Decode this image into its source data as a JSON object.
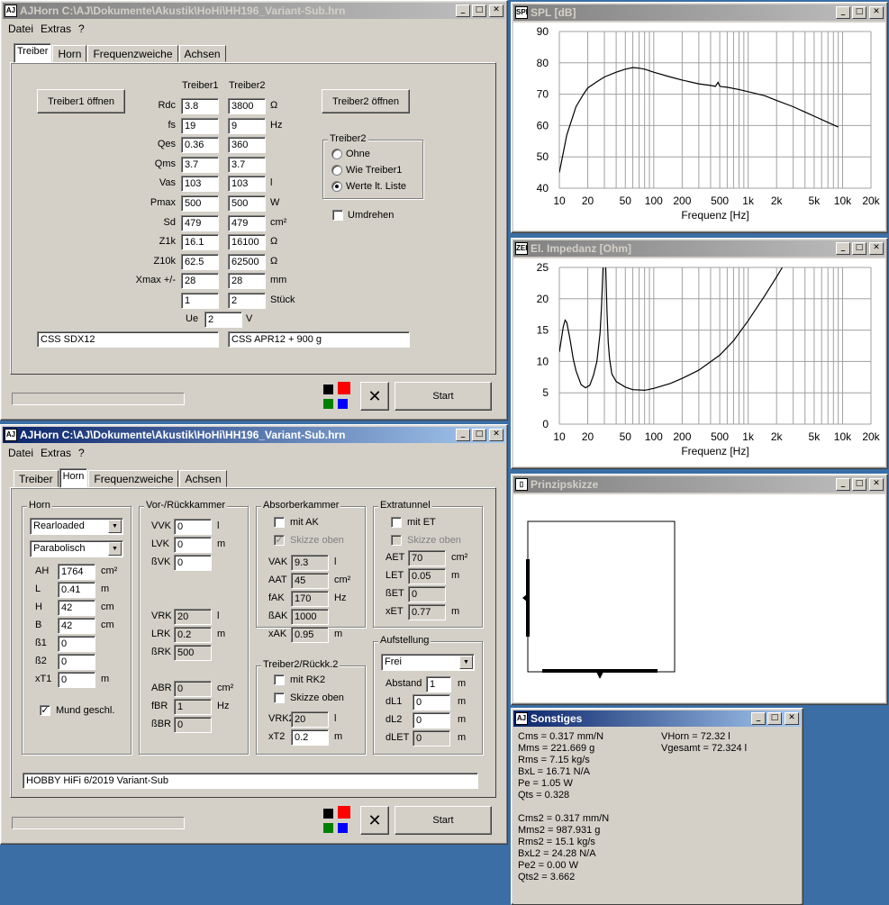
{
  "win1": {
    "title": "AJHorn  C:\\AJ\\Dokumente\\Akustik\\HoHi\\HH196_Variant-Sub.hrn",
    "menu": [
      "Datei",
      "Extras",
      "?"
    ],
    "tabs": [
      "Treiber",
      "Horn",
      "Frequenzweiche",
      "Achsen"
    ],
    "active_tab": "Treiber",
    "btn_t1": "Treiber1 öffnen",
    "btn_t2": "Treiber2 öffnen",
    "col1": "Treiber1",
    "col2": "Treiber2",
    "rows": [
      {
        "label": "Rdc",
        "v1": "3.8",
        "v2": "3800",
        "unit": "Ω"
      },
      {
        "label": "fs",
        "v1": "19",
        "v2": "9",
        "unit": "Hz"
      },
      {
        "label": "Qes",
        "v1": "0.36",
        "v2": "360",
        "unit": ""
      },
      {
        "label": "Qms",
        "v1": "3.7",
        "v2": "3.7",
        "unit": ""
      },
      {
        "label": "Vas",
        "v1": "103",
        "v2": "103",
        "unit": "l"
      },
      {
        "label": "Pmax",
        "v1": "500",
        "v2": "500",
        "unit": "W"
      },
      {
        "label": "Sd",
        "v1": "479",
        "v2": "479",
        "unit": "cm²"
      },
      {
        "label": "Z1k",
        "v1": "16.1",
        "v2": "16100",
        "unit": "Ω"
      },
      {
        "label": "Z10k",
        "v1": "62.5",
        "v2": "62500",
        "unit": "Ω"
      },
      {
        "label": "Xmax +/-",
        "v1": "28",
        "v2": "28",
        "unit": "mm"
      },
      {
        "label": "",
        "v1": "1",
        "v2": "2",
        "unit": "Stück"
      }
    ],
    "ue_label": "Ue",
    "ue_value": "2",
    "ue_unit": "V",
    "treiber2_group": "Treiber2",
    "radio": [
      "Ohne",
      "Wie Treiber1",
      "Werte lt. Liste"
    ],
    "radio_selected": 2,
    "umdrehen": "Umdrehen",
    "name1": "CSS SDX12",
    "name2": "CSS APR12 + 900 g",
    "start": "Start",
    "swatch_colors": [
      "#000000",
      "#ff0000",
      "#008000",
      "#0000ff"
    ]
  },
  "win2": {
    "title": "AJHorn  C:\\AJ\\Dokumente\\Akustik\\HoHi\\HH196_Variant-Sub.hrn",
    "menu": [
      "Datei",
      "Extras",
      "?"
    ],
    "tabs": [
      "Treiber",
      "Horn",
      "Frequenzweiche",
      "Achsen"
    ],
    "active_tab": "Horn",
    "horn": {
      "group": "Horn",
      "type": "Rearloaded",
      "shape": "Parabolisch",
      "fields": [
        {
          "label": "AH",
          "value": "1764",
          "unit": "cm²"
        },
        {
          "label": "L",
          "value": "0.41",
          "unit": "m"
        },
        {
          "label": "H",
          "value": "42",
          "unit": "cm"
        },
        {
          "label": "B",
          "value": "42",
          "unit": "cm"
        },
        {
          "label": "ß1",
          "value": "0",
          "unit": ""
        },
        {
          "label": "ß2",
          "value": "0",
          "unit": ""
        },
        {
          "label": "xT1",
          "value": "0",
          "unit": "m"
        }
      ],
      "mund": "Mund geschl."
    },
    "kammer": {
      "group": "Vor-/Rückkammer",
      "top": [
        {
          "label": "VVK",
          "value": "0",
          "unit": "l"
        },
        {
          "label": "LVK",
          "value": "0",
          "unit": "m"
        },
        {
          "label": "ßVK",
          "value": "0",
          "unit": ""
        }
      ],
      "mid": [
        {
          "label": "VRK",
          "value": "20",
          "unit": "l"
        },
        {
          "label": "LRK",
          "value": "0.2",
          "unit": "m"
        },
        {
          "label": "ßRK",
          "value": "500",
          "unit": ""
        }
      ],
      "bot": [
        {
          "label": "ABR",
          "value": "0",
          "unit": "cm²"
        },
        {
          "label": "fBR",
          "value": "1",
          "unit": "Hz"
        },
        {
          "label": "ßBR",
          "value": "0",
          "unit": ""
        }
      ]
    },
    "absorber": {
      "group": "Absorberkammer",
      "mit": "mit AK",
      "skizze": "Skizze oben",
      "fields": [
        {
          "label": "VAK",
          "value": "9.3",
          "unit": "l"
        },
        {
          "label": "AAT",
          "value": "45",
          "unit": "cm²"
        },
        {
          "label": "fAK",
          "value": "170",
          "unit": "Hz"
        },
        {
          "label": "ßAK",
          "value": "1000",
          "unit": ""
        },
        {
          "label": "xAK",
          "value": "0.95",
          "unit": "m"
        }
      ]
    },
    "rueck2": {
      "group": "Treiber2/Rückk.2",
      "mit": "mit RK2",
      "skizze": "Skizze oben",
      "fields": [
        {
          "label": "VRK2",
          "value": "20",
          "unit": "l"
        },
        {
          "label": "xT2",
          "value": "0.2",
          "unit": "m"
        }
      ]
    },
    "extratunnel": {
      "group": "Extratunnel",
      "mit": "mit ET",
      "skizze": "Skizze oben",
      "fields": [
        {
          "label": "AET",
          "value": "70",
          "unit": "cm²"
        },
        {
          "label": "LET",
          "value": "0.05",
          "unit": "m"
        },
        {
          "label": "ßET",
          "value": "0",
          "unit": ""
        },
        {
          "label": "xET",
          "value": "0.77",
          "unit": "m"
        }
      ]
    },
    "aufstellung": {
      "group": "Aufstellung",
      "mode": "Frei",
      "fields": [
        {
          "label": "Abstand",
          "value": "1",
          "unit": "m"
        },
        {
          "label": "dL1",
          "value": "0",
          "unit": "m"
        },
        {
          "label": "dL2",
          "value": "0",
          "unit": "m"
        },
        {
          "label": "dLET",
          "value": "0",
          "unit": "m"
        }
      ]
    },
    "comment": "HOBBY HiFi 6/2019 Variant-Sub",
    "start": "Start"
  },
  "spl": {
    "icon": "SPL",
    "title": "SPL [dB]",
    "xlabel": "Frequenz [Hz]",
    "xticks": [
      "10",
      "20",
      "50",
      "100",
      "200",
      "500",
      "1k",
      "2k",
      "5k",
      "10k",
      "20k"
    ],
    "yticks": [
      "90",
      "80",
      "70",
      "60",
      "50",
      "40"
    ]
  },
  "imp": {
    "icon": "ZEL",
    "title": "El. Impedanz [Ohm]",
    "xlabel": "Frequenz [Hz]",
    "xticks": [
      "10",
      "20",
      "50",
      "100",
      "200",
      "500",
      "1k",
      "2k",
      "5k",
      "10k",
      "20k"
    ],
    "yticks": [
      "25",
      "20",
      "15",
      "10",
      "5",
      "0"
    ]
  },
  "skizze": {
    "title": "Prinzipskizze"
  },
  "sonstiges": {
    "title": "Sonstiges",
    "left": [
      "Cms = 0.317 mm/N",
      "Mms = 221.669 g",
      "Rms = 7.15 kg/s",
      "BxL = 16.71 N/A",
      "Pe = 1.05 W",
      "Qts = 0.328",
      "",
      "Cms2 = 0.317 mm/N",
      "Mms2 = 987.931 g",
      "Rms2 = 15.1 kg/s",
      "BxL2 = 24.28 N/A",
      "Pe2 = 0.00 W",
      "Qts2 = 3.662"
    ],
    "right": [
      "VHorn = 72.32 l",
      "Vgesamt = 72.324 l"
    ]
  },
  "chart_data": [
    {
      "type": "line",
      "title": "SPL [dB]",
      "xlabel": "Frequenz [Hz]",
      "ylabel": "",
      "xscale": "log",
      "xlim": [
        10,
        20000
      ],
      "ylim": [
        40,
        90
      ],
      "grid": true,
      "series": [
        {
          "x": [
            10,
            12,
            15,
            18,
            20,
            25,
            30,
            40,
            50,
            60,
            70,
            80,
            100,
            150,
            200,
            300,
            400,
            450,
            480,
            500,
            520,
            600,
            800,
            1000,
            1500,
            2000,
            3000,
            5000,
            7000,
            9000
          ],
          "y": [
            45,
            57,
            66,
            70,
            72,
            74,
            75.5,
            77,
            78,
            78.5,
            78.3,
            78,
            77,
            75.5,
            74.5,
            73.3,
            72.8,
            72.5,
            73.8,
            72.6,
            72.4,
            72.2,
            71.5,
            70.8,
            69.5,
            68,
            66,
            63,
            61,
            59.5
          ]
        }
      ]
    },
    {
      "type": "line",
      "title": "El. Impedanz [Ohm]",
      "xlabel": "Frequenz [Hz]",
      "ylabel": "",
      "xscale": "log",
      "xlim": [
        10,
        20000
      ],
      "ylim": [
        0,
        25
      ],
      "grid": true,
      "series": [
        {
          "x": [
            10,
            10.5,
            11,
            11.5,
            12,
            13,
            14,
            15,
            17,
            19,
            21,
            23,
            25,
            27,
            28,
            29,
            30,
            31,
            32,
            33,
            34,
            36,
            40,
            50,
            60,
            80,
            100,
            150,
            200,
            300,
            500,
            700,
            1000,
            1500,
            2000,
            2300
          ],
          "y": [
            11.5,
            13.5,
            15.5,
            16.6,
            16.2,
            13.5,
            10.5,
            8.5,
            6.3,
            5.8,
            6.2,
            7.8,
            10,
            14.5,
            19,
            25,
            28,
            25,
            18,
            13,
            10.5,
            8,
            6.8,
            5.9,
            5.5,
            5.4,
            5.7,
            6.5,
            7.3,
            8.6,
            11,
            13.3,
            16.5,
            20.5,
            23.5,
            25
          ]
        }
      ]
    }
  ]
}
